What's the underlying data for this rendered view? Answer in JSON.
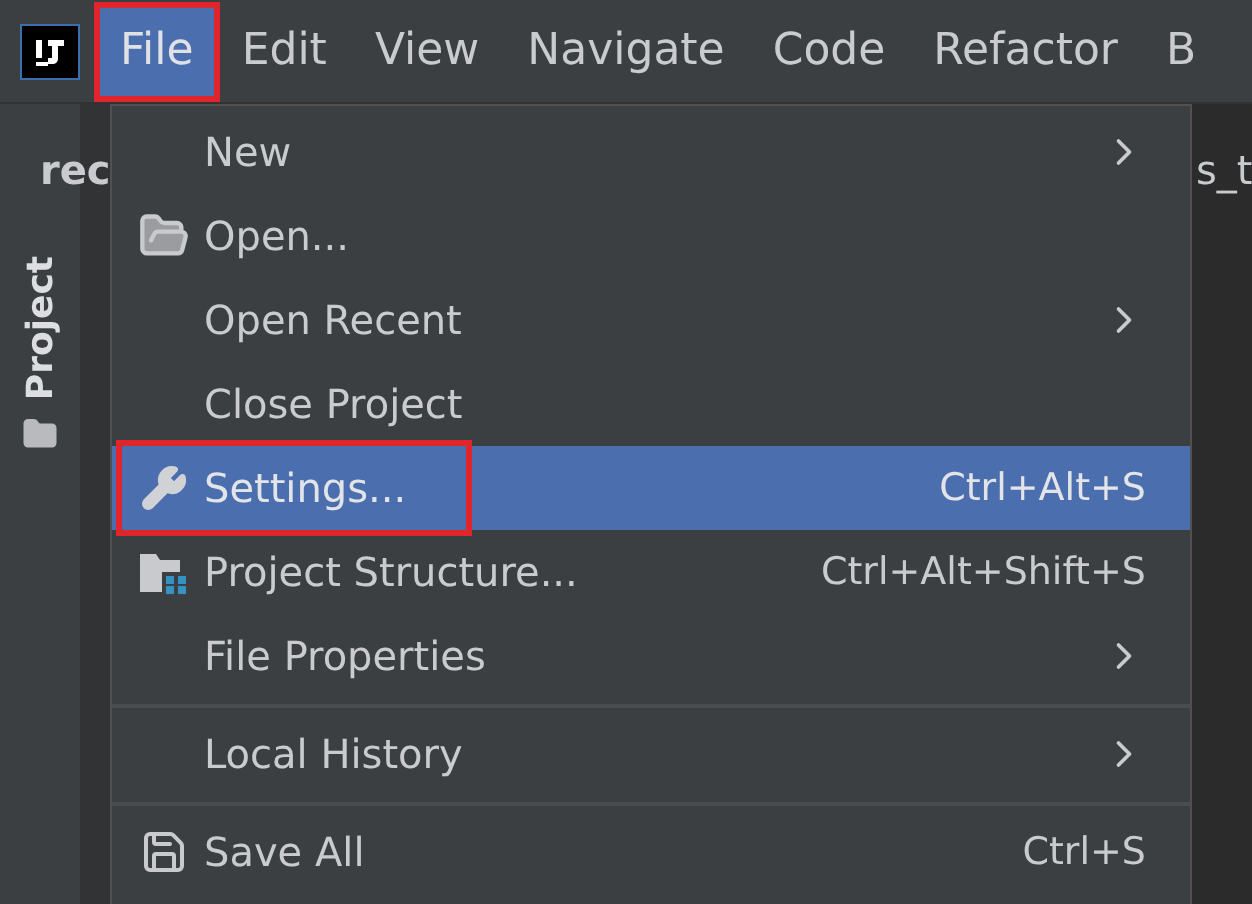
{
  "menubar": {
    "items": [
      {
        "label": "File",
        "selected": true,
        "marked": true
      },
      {
        "label": "Edit",
        "selected": false,
        "marked": false
      },
      {
        "label": "View",
        "selected": false,
        "marked": false
      },
      {
        "label": "Navigate",
        "selected": false,
        "marked": false
      },
      {
        "label": "Code",
        "selected": false,
        "marked": false
      },
      {
        "label": "Refactor",
        "selected": false,
        "marked": false
      },
      {
        "label": "B",
        "selected": false,
        "marked": false
      }
    ]
  },
  "left_panel": {
    "tab_text": "rec",
    "tool_tab": "Project"
  },
  "right_panel": {
    "tab_text": "s_t"
  },
  "file_menu": {
    "items": [
      {
        "kind": "plain",
        "label": "New",
        "submenu": true,
        "selected": false,
        "marked": false
      },
      {
        "kind": "open",
        "label": "Open...",
        "submenu": false,
        "selected": false,
        "marked": false
      },
      {
        "kind": "plain",
        "label": "Open Recent",
        "submenu": true,
        "selected": false,
        "marked": false
      },
      {
        "kind": "plain",
        "label": "Close Project",
        "submenu": false,
        "selected": false,
        "marked": false
      },
      {
        "kind": "settings",
        "label": "Settings...",
        "shortcut": "Ctrl+Alt+S",
        "submenu": false,
        "selected": true,
        "marked": true
      },
      {
        "kind": "structure",
        "label": "Project Structure...",
        "shortcut": "Ctrl+Alt+Shift+S",
        "submenu": false,
        "selected": false,
        "marked": false
      },
      {
        "kind": "plain",
        "label": "File Properties",
        "submenu": true,
        "selected": false,
        "marked": false
      },
      {
        "kind": "separator"
      },
      {
        "kind": "plain",
        "label": "Local History",
        "submenu": true,
        "selected": false,
        "marked": false
      },
      {
        "kind": "separator"
      },
      {
        "kind": "save",
        "label": "Save All",
        "shortcut": "Ctrl+S",
        "submenu": false,
        "selected": false,
        "marked": false
      }
    ]
  }
}
